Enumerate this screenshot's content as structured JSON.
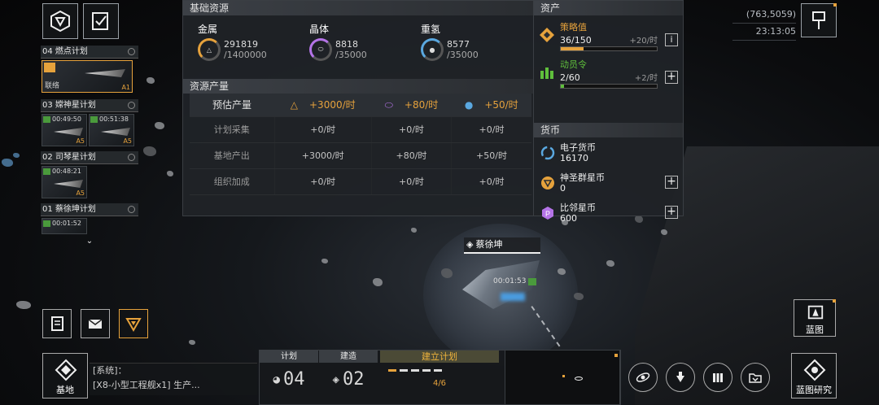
{
  "top_left": {
    "btn1_icon": "hex-target-icon",
    "btn2_icon": "checklist-icon"
  },
  "plans": [
    {
      "title": "04 燃点计划",
      "card_label": "联络",
      "card_level": "A1"
    },
    {
      "title": "03 嫦神星计划",
      "cards": [
        {
          "time": "00:49:50",
          "level": "A5"
        },
        {
          "time": "00:51:38",
          "level": "A5"
        }
      ]
    },
    {
      "title": "02 司琴星计划",
      "cards": [
        {
          "time": "00:48:21",
          "level": "A5"
        }
      ]
    },
    {
      "title": "01 蔡徐坤计划",
      "cards": [
        {
          "time": "00:01:52"
        }
      ]
    }
  ],
  "panel": {
    "base_title": "基础资源",
    "resources": [
      {
        "name": "金属",
        "value": "291819",
        "cap": "/1400000",
        "color": "#e6a23c"
      },
      {
        "name": "晶体",
        "value": "8818",
        "cap": "/35000",
        "color": "#b574e8"
      },
      {
        "name": "重氢",
        "value": "8577",
        "cap": "/35000",
        "color": "#5aa8e0"
      }
    ],
    "prod_title": "资源产量",
    "prod_header": {
      "label": "预估产量",
      "metal": "+3000/时",
      "crystal": "+80/时",
      "deut": "+50/时"
    },
    "prod_rows": [
      {
        "label": "计划采集",
        "metal": "+0/时",
        "crystal": "+0/时",
        "deut": "+0/时"
      },
      {
        "label": "基地产出",
        "metal": "+3000/时",
        "crystal": "+80/时",
        "deut": "+50/时"
      },
      {
        "label": "组织加成",
        "metal": "+0/时",
        "crystal": "+0/时",
        "deut": "+0/时"
      }
    ],
    "assets_title": "资产",
    "assets": [
      {
        "name": "策略值",
        "value": "36/150",
        "inc": "+20/时",
        "fill": 0.24,
        "color": "#e6a23c"
      },
      {
        "name": "动员令",
        "value": "2/60",
        "inc": "+2/时",
        "fill": 0.033,
        "color": "#5fbf3c"
      }
    ],
    "currency_title": "货币",
    "currencies": [
      {
        "name": "电子货币",
        "value": "16170"
      },
      {
        "name": "神圣群星币",
        "value": "0"
      },
      {
        "name": "比邻星币",
        "value": "600"
      }
    ]
  },
  "top_right": {
    "coords": "(763,5059)",
    "time": "23:13:05"
  },
  "marker": {
    "name": "蔡徐坤",
    "time": "00:01:53"
  },
  "bottom": {
    "base_label": "基地",
    "msg_line1": "[系统]：",
    "msg_line2": "[X8-小型工程舰x1] 生产...",
    "tab_plan": "计划",
    "tab_plan_num": "04",
    "tab_build": "建造",
    "tab_build_num": "02",
    "tab_establish": "建立计划",
    "establish_progress": "4/6",
    "blueprint_label": "蓝图",
    "blueprint_research_label": "蓝图研究"
  }
}
